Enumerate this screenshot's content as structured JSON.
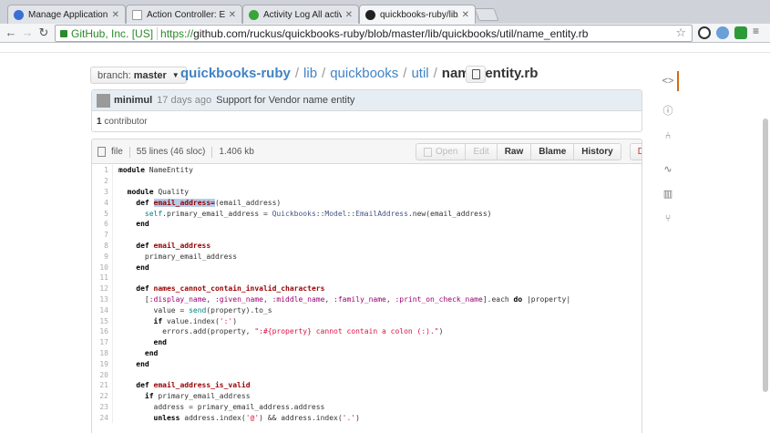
{
  "browser": {
    "tabs": [
      {
        "title": "Manage Application | Intu",
        "favicon_color": "#3b6fd6",
        "active": false
      },
      {
        "title": "Action Controller: Excepti",
        "favicon_color": "#ffffff",
        "active": false
      },
      {
        "title": "Activity Log All activities ·",
        "favicon_color": "#3aa33a",
        "active": false
      },
      {
        "title": "quickbooks-ruby/lib/quic",
        "favicon_color": "#222222",
        "active": true
      }
    ],
    "ev_name": "GitHub, Inc. [US]",
    "url_scheme": "https://",
    "url_rest": "github.com/ruckus/quickbooks-ruby/blob/master/lib/quickbooks/util/name_entity.rb"
  },
  "repo": {
    "branch_label": "branch:",
    "branch_name": "master",
    "repo_name": "quickbooks-ruby",
    "sep": "/",
    "dir1": "lib",
    "dir2": "quickbooks",
    "dir3": "util",
    "file_name": "name_entity.rb"
  },
  "commit": {
    "author": "minimul",
    "ago": "17 days ago",
    "message": "Support for Vendor name entity",
    "contributors_count": "1",
    "contributors_label": "contributor"
  },
  "file": {
    "type": "file",
    "lines": "55 lines (46 sloc)",
    "size": "1.406 kb",
    "buttons": {
      "open": "Open",
      "edit": "Edit",
      "raw": "Raw",
      "blame": "Blame",
      "history": "History",
      "delete": "Delete"
    }
  },
  "code_lines": [
    {
      "n": "1",
      "text": "module NameEntity"
    },
    {
      "n": "2",
      "text": ""
    },
    {
      "n": "3",
      "text": "  module Quality"
    },
    {
      "n": "4",
      "text": "    def email_address=(email_address)"
    },
    {
      "n": "5",
      "text": "      self.primary_email_address = Quickbooks::Model::EmailAddress.new(email_address)"
    },
    {
      "n": "6",
      "text": "    end"
    },
    {
      "n": "7",
      "text": ""
    },
    {
      "n": "8",
      "text": "    def email_address"
    },
    {
      "n": "9",
      "text": "      primary_email_address"
    },
    {
      "n": "10",
      "text": "    end"
    },
    {
      "n": "11",
      "text": ""
    },
    {
      "n": "12",
      "text": "    def names_cannot_contain_invalid_characters"
    },
    {
      "n": "13",
      "text": "      [:display_name, :given_name, :middle_name, :family_name, :print_on_check_name].each do |property|"
    },
    {
      "n": "14",
      "text": "        value = send(property).to_s"
    },
    {
      "n": "15",
      "text": "        if value.index(':')"
    },
    {
      "n": "16",
      "text": "          errors.add(property, \":#{property} cannot contain a colon (:).\")"
    },
    {
      "n": "17",
      "text": "        end"
    },
    {
      "n": "18",
      "text": "      end"
    },
    {
      "n": "19",
      "text": "    end"
    },
    {
      "n": "20",
      "text": ""
    },
    {
      "n": "21",
      "text": "    def email_address_is_valid"
    },
    {
      "n": "22",
      "text": "      if primary_email_address"
    },
    {
      "n": "23",
      "text": "        address = primary_email_address.address"
    },
    {
      "n": "24",
      "text": "        unless address.index('@') && address.index('.')"
    }
  ],
  "sidebar_icons": [
    "code-icon",
    "issues-icon",
    "pull-request-icon",
    "pulse-icon",
    "graphs-icon",
    "branch-network-icon"
  ],
  "colors": {
    "link": "#4183c4",
    "ev_green": "#2a8a2a",
    "active_tab_marker": "#d26911",
    "selection": "#b4cdea"
  }
}
